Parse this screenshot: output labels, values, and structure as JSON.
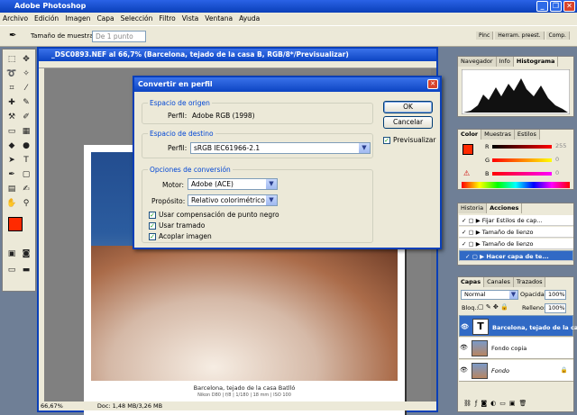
{
  "app": {
    "title": "Adobe Photoshop",
    "accent": "#0a3fb8"
  },
  "menu": [
    "Archivo",
    "Edición",
    "Imagen",
    "Capa",
    "Selección",
    "Filtro",
    "Vista",
    "Ventana",
    "Ayuda"
  ],
  "options": {
    "sample_label": "Tamaño de muestra:",
    "sample_value": "De 1 punto",
    "tabs": [
      "Pinc",
      "Herram. preest.",
      "Comp."
    ]
  },
  "document": {
    "title": "_DSC0893.NEF al 66,7% (Barcelona, tejado de la casa B, RGB/8*/Previsualizar)",
    "caption": "Barcelona, tejado de la casa Batlló",
    "meta": "Nikon D80  |  f/8 | 1/180 | 18 mm | ISO 100",
    "zoom": "66,67%",
    "doc_size": "Doc: 1,48 MB/3,26 MB"
  },
  "dialog": {
    "title": "Convertir en perfil",
    "origin_label": "Espacio de origen",
    "origin_profile_label": "Perfil:",
    "origin_profile": "Adobe RGB (1998)",
    "dest_label": "Espacio de destino",
    "dest_profile_label": "Perfil:",
    "dest_profile": "sRGB IEC61966-2.1",
    "conv_label": "Opciones de conversión",
    "engine_label": "Motor:",
    "engine": "Adobe (ACE)",
    "intent_label": "Propósito:",
    "intent": "Relativo colorimétrico",
    "check_bpc": "Usar compensación de punto negro",
    "check_dither": "Usar tramado",
    "check_flatten": "Acoplar imagen",
    "ok": "OK",
    "cancel": "Cancelar",
    "preview": "Previsualizar"
  },
  "navigator": {
    "tabs": [
      "Navegador",
      "Info",
      "Histograma"
    ]
  },
  "color": {
    "tabs": [
      "Color",
      "Muestras",
      "Estilos"
    ],
    "r_label": "R",
    "g_label": "G",
    "b_label": "B",
    "r": "255",
    "g": "0",
    "b": "0",
    "swatch": "#ff2a00"
  },
  "actions": {
    "tabs": [
      "Historia",
      "Acciones"
    ],
    "items": [
      "Fijar Estilos de cap...",
      "Tamaño de lienzo",
      "Tamaño de lienzo",
      "Hacer capa de te..."
    ]
  },
  "layers": {
    "tabs": [
      "Capas",
      "Canales",
      "Trazados"
    ],
    "blend": "Normal",
    "opacity_label": "Opacidad:",
    "opacity": "100%",
    "lock_label": "Bloq.:",
    "fill_label": "Relleno:",
    "fill": "100%",
    "items": [
      "Barcelona, tejado de la casa B",
      "Fondo copia",
      "Fondo"
    ]
  },
  "toolbox": {
    "fg_color": "#ff2a00",
    "bg_color": "#ffffff"
  }
}
